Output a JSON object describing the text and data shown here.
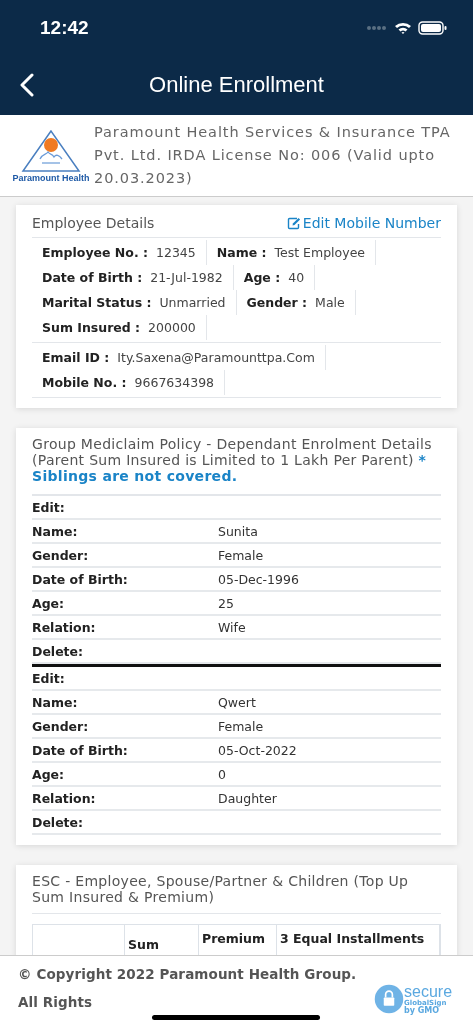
{
  "status_bar": {
    "time": "12:42"
  },
  "header": {
    "title": "Online Enrollment"
  },
  "brand": {
    "logo_text": "Paramount Health",
    "text": "Paramount Health Services & Insurance TPA Pvt. Ltd. IRDA License No: 006 (Valid upto 20.03.2023)"
  },
  "employee": {
    "title": "Employee Details",
    "edit_link": "Edit Mobile Number",
    "fields": [
      {
        "label": "Employee No. :",
        "value": "12345"
      },
      {
        "label": "Name :",
        "value": "Test Employee"
      },
      {
        "label": "Date of Birth :",
        "value": "21-Jul-1982"
      },
      {
        "label": "Age :",
        "value": "40"
      },
      {
        "label": "Marital Status :",
        "value": "Unmarried"
      },
      {
        "label": "Gender :",
        "value": "Male"
      },
      {
        "label": "Sum Insured :",
        "value": "200000"
      }
    ],
    "contact": [
      {
        "label": "Email ID :",
        "value": "Ity.Saxena@Paramounttpa.Com"
      },
      {
        "label": "Mobile No. :",
        "value": "9667634398"
      }
    ]
  },
  "dependants": {
    "title": "Group Mediclaim Policy - Dependant Enrolment Details (Parent Sum Insured is Limited to 1 Lakh Per Parent) *** Siblings are not covered.**",
    "items": [
      {
        "rows": [
          {
            "label": "Edit:"
          },
          {
            "label": "Name:",
            "value": "Sunita"
          },
          {
            "label": "Gender:",
            "value": "Female"
          },
          {
            "label": "Date of Birth:",
            "value": "05-Dec-1996"
          },
          {
            "label": "Age:",
            "value": "25"
          },
          {
            "label": "Relation:",
            "value": "Wife"
          },
          {
            "label": "Delete:"
          }
        ]
      },
      {
        "rows": [
          {
            "label": "Edit:"
          },
          {
            "label": "Name:",
            "value": "Qwert"
          },
          {
            "label": "Gender:",
            "value": "Female"
          },
          {
            "label": "Date of Birth:",
            "value": "05-Oct-2022"
          },
          {
            "label": "Age:",
            "value": "0"
          },
          {
            "label": "Relation:",
            "value": "Daughter"
          },
          {
            "label": "Delete:"
          }
        ]
      }
    ]
  },
  "topup": {
    "title": "ESC - Employee, Spouse/Partner & Children (Top Up Sum Insured & Premium)",
    "columns": [
      "",
      "Sum",
      "Premium",
      "3 Equal Installments"
    ]
  },
  "footer": {
    "text": "© Copyright 2022 Paramount Health Group. All Rights",
    "seal": {
      "word": "secure",
      "brand": "GlobalSign",
      "sub": "by GMO"
    }
  }
}
